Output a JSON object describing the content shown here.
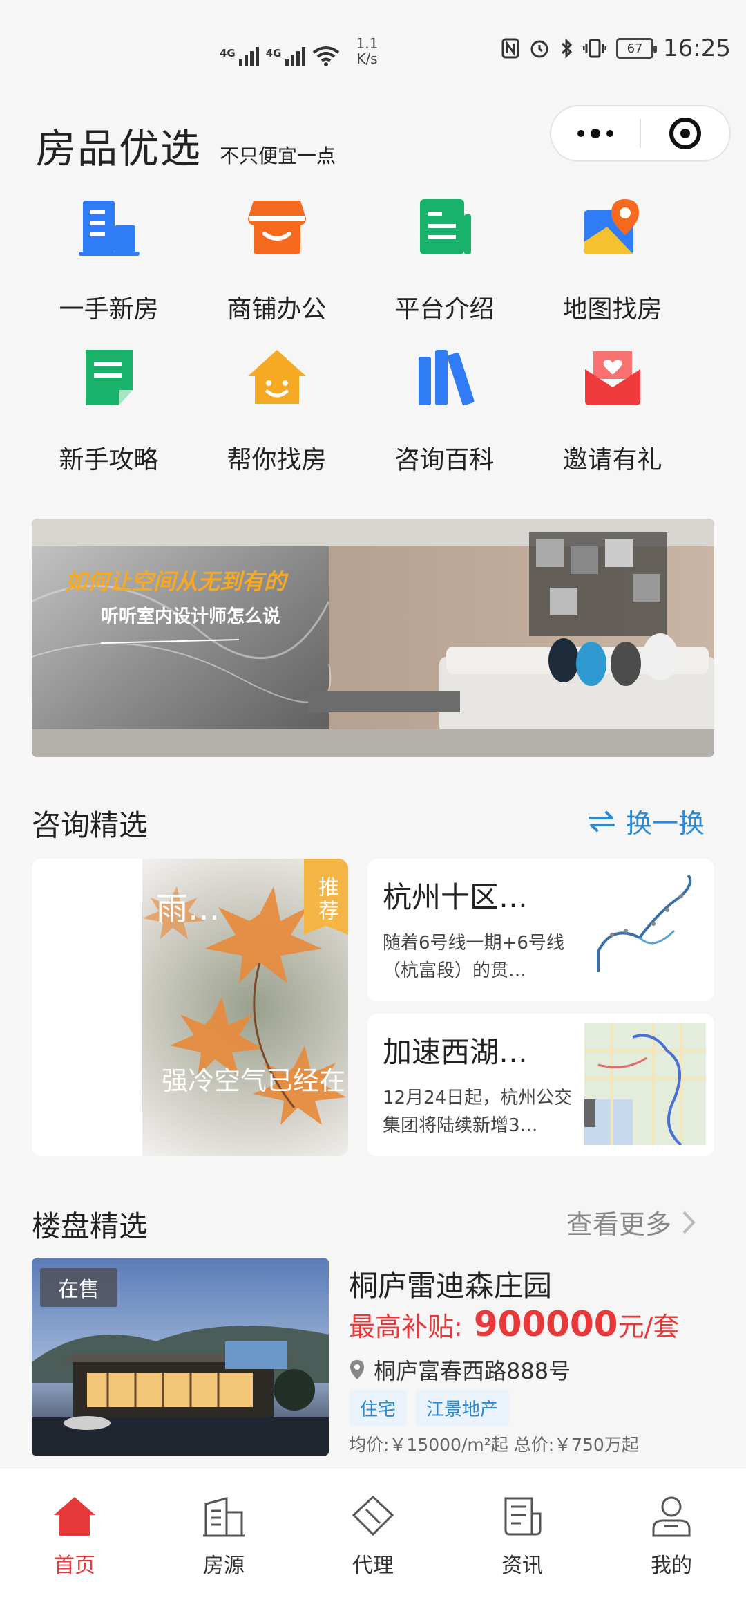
{
  "status_bar": {
    "net1": "4G",
    "net2": "4G",
    "speed_value": "1.1",
    "speed_unit": "K/s",
    "battery": "67",
    "time": "16:25"
  },
  "header": {
    "title": "房品优选",
    "subtitle": "不只便宜一点"
  },
  "grid": [
    {
      "label": "一手新房",
      "icon": "building-icon"
    },
    {
      "label": "商铺办公",
      "icon": "shop-icon"
    },
    {
      "label": "平台介绍",
      "icon": "document-icon"
    },
    {
      "label": "地图找房",
      "icon": "map-pin-icon"
    },
    {
      "label": "新手攻略",
      "icon": "note-icon"
    },
    {
      "label": "帮你找房",
      "icon": "smiley-house-icon"
    },
    {
      "label": "咨询百科",
      "icon": "books-icon"
    },
    {
      "label": "邀请有礼",
      "icon": "gift-envelope-icon"
    }
  ],
  "banner": {
    "headline": "如何让空间从无到有的",
    "subline": "听听室内设计师怎么说"
  },
  "consult": {
    "title": "咨询精选",
    "refresh_label": "换一换",
    "featured": {
      "title": "雨…",
      "text": "强冷空气已经在",
      "tag": "推荐"
    },
    "news": [
      {
        "title": "杭州十区…",
        "desc": "随着6号线一期+6号线（杭富段）的贯…"
      },
      {
        "title": "加速西湖…",
        "desc": "12月24日起，杭州公交集团将陆续新增3…"
      }
    ]
  },
  "property_section": {
    "title": "楼盘精选",
    "more_label": "查看更多"
  },
  "property": {
    "status": "在售",
    "name": "桐庐雷迪森庄园",
    "subsidy_label": "最高补贴:",
    "subsidy_value": "900000",
    "subsidy_unit": "元/套",
    "address": "桐庐富春西路888号",
    "tags": [
      "住宅",
      "江景地产"
    ],
    "prices": "均价:￥15000/m²起  总价:￥750万起"
  },
  "tabbar": [
    {
      "label": "首页",
      "icon": "home-icon",
      "active": true
    },
    {
      "label": "房源",
      "icon": "building-outline-icon",
      "active": false
    },
    {
      "label": "代理",
      "icon": "diamond-icon",
      "active": false
    },
    {
      "label": "资讯",
      "icon": "newspaper-icon",
      "active": false
    },
    {
      "label": "我的",
      "icon": "user-icon",
      "active": false
    }
  ],
  "colors": {
    "accent": "#e8393a",
    "link_blue": "#2a8ad6",
    "tag_bg": "#eaf3fb",
    "rec_tag": "#f4b545"
  }
}
